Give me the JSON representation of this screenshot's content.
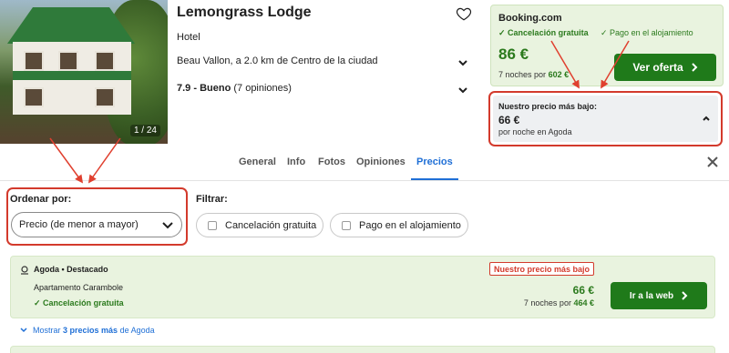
{
  "hotel": {
    "photo_counter": "1 / 24",
    "name": "Lemongrass Lodge",
    "type": "Hotel",
    "location": "Beau Vallon, a 2.0 km de Centro de la ciudad",
    "rating_score": "7.9 - Bueno",
    "rating_count": "(7 opiniones)"
  },
  "booking": {
    "provider": "Booking.com",
    "feature_1": "Cancelación gratuita",
    "feature_2": "Pago en el alojamiento",
    "price": "86 €",
    "nights_text": "7 noches por",
    "nights_total": "602 €",
    "button": "Ver oferta"
  },
  "lowest": {
    "label": "Nuestro precio más bajo:",
    "price": "66 €",
    "sub": "por noche en Agoda"
  },
  "tabs": [
    {
      "label": "General"
    },
    {
      "label": "Info"
    },
    {
      "label": "Fotos"
    },
    {
      "label": "Opiniones"
    },
    {
      "label": "Precios"
    }
  ],
  "active_tab": "Precios",
  "sort": {
    "label": "Ordenar por:",
    "value": "Precio (de menor a mayor)"
  },
  "filter": {
    "label": "Filtrar:",
    "options": [
      {
        "label": "Cancelación gratuita",
        "checked": false
      },
      {
        "label": "Pago en el alojamiento",
        "checked": false
      }
    ]
  },
  "result": {
    "provider": "Agoda • Destacado",
    "room": "Apartamento Carambole",
    "cancel": "Cancelación gratuita",
    "badge": "Nuestro precio más bajo",
    "price": "66 €",
    "nights_text": "7 noches por",
    "nights_total": "464 €",
    "button": "Ir a la web"
  },
  "more": {
    "prefix": "Mostrar",
    "count": "3 precios más",
    "suffix": "de Agoda"
  },
  "colors": {
    "accent_green": "#1f7a1a",
    "price_green": "#2b7a1d",
    "link_blue": "#1f6fd6",
    "highlight_red": "#d33a2c",
    "card_green_bg": "#e9f3df"
  }
}
